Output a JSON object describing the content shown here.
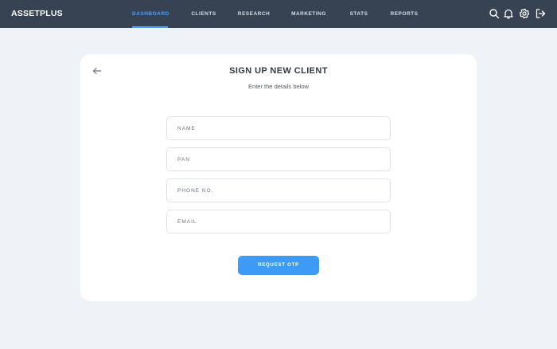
{
  "app": {
    "brand": "ASSETPLUS"
  },
  "nav": {
    "items": [
      {
        "label": "DASHBOARD",
        "active": true
      },
      {
        "label": "CLIENTS",
        "active": false
      },
      {
        "label": "RESEARCH",
        "active": false
      },
      {
        "label": "MARKETING",
        "active": false
      },
      {
        "label": "STATS",
        "active": false
      },
      {
        "label": "REPORTS",
        "active": false
      }
    ]
  },
  "toolbar": {
    "icons": [
      "search-icon",
      "bell-icon",
      "gear-icon",
      "logout-icon"
    ]
  },
  "form": {
    "title": "SIGN UP NEW CLIENT",
    "subtitle": "Enter the details below",
    "fields": [
      {
        "placeholder": "NAME",
        "value": ""
      },
      {
        "placeholder": "PAN",
        "value": ""
      },
      {
        "placeholder": "PHONE NO.",
        "value": ""
      },
      {
        "placeholder": "EMAIL",
        "value": ""
      }
    ],
    "submit_label": "REQUEST OTP"
  },
  "colors": {
    "topbar": "#374253",
    "accent": "#4aa3ff",
    "button": "#3d9bf5",
    "background": "#eff2f6"
  }
}
